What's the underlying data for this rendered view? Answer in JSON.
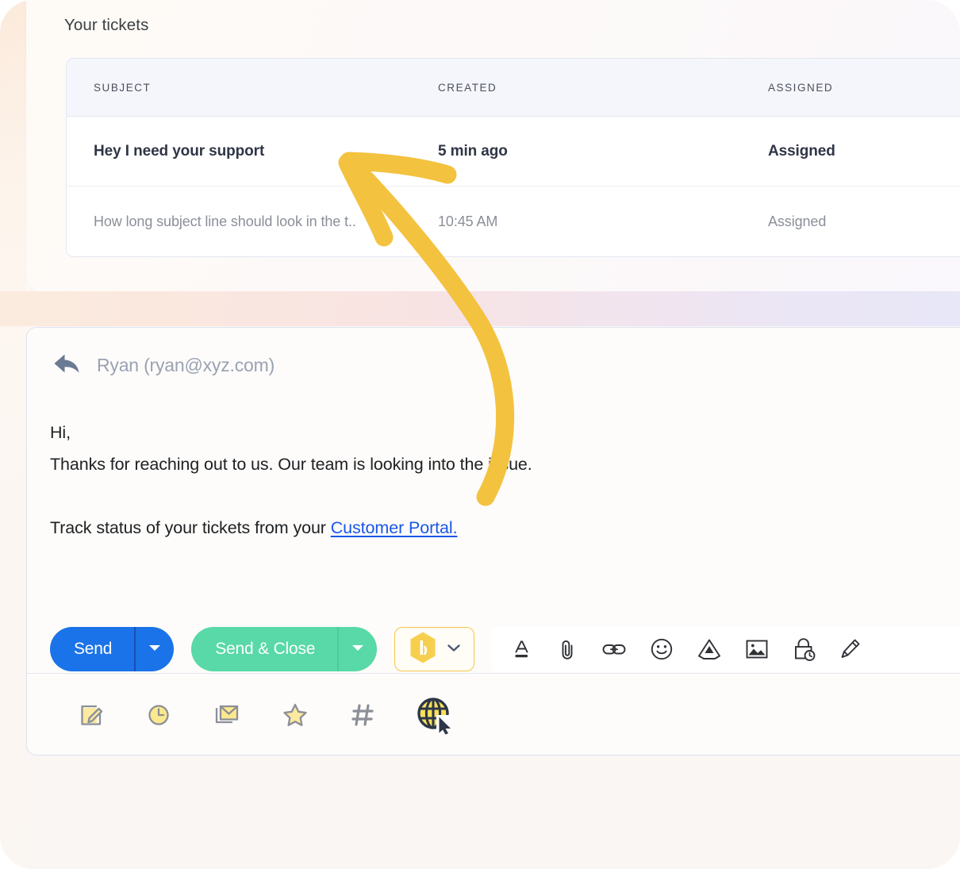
{
  "tickets": {
    "title": "Your tickets",
    "columns": [
      "SUBJECT",
      "CREATED",
      "ASSIGNED"
    ],
    "rows": [
      {
        "subject": "Hey I need your support",
        "created": "5 min ago",
        "assigned": "Assigned",
        "unread": true
      },
      {
        "subject": "How long subject line should look in the t..",
        "created": "10:45 AM",
        "assigned": "Assigned",
        "unread": false
      }
    ]
  },
  "reply": {
    "reply_icon": "reply-arrow-icon",
    "recipient": "Ryan (ryan@xyz.com)",
    "body": {
      "greeting": "Hi,",
      "line1": "Thanks for reaching out to us. Our team is looking into the issue.",
      "line2_prefix": "Track status of your tickets from your ",
      "link_text": "Customer Portal."
    },
    "actions": {
      "send_label": "Send",
      "send_caret": "chevron-down-icon",
      "send_close_label": "Send & Close",
      "send_close_caret": "chevron-down-icon",
      "hiver_icon": "hiver-hexagon-icon",
      "hiver_caret": "chevron-down-icon"
    },
    "format_tools": [
      "text-format-icon",
      "attachment-paperclip-icon",
      "insert-link-icon",
      "emoji-smiley-icon",
      "google-drive-icon",
      "insert-image-icon",
      "confidential-lock-icon",
      "pen-marker-icon"
    ],
    "bottom_tools": [
      "compose-note-icon",
      "snooze-clock-icon",
      "email-template-icon",
      "star-icon",
      "hashtag-tag-icon",
      "globe-cursor-icon"
    ]
  },
  "colors": {
    "send_blue": "#1a73e8",
    "send_close_green": "#58d9a7",
    "hiver_yellow": "#f7cf4f",
    "annotation_yellow": "#f3c23f",
    "link_blue": "#1a56e8",
    "header_bg": "#f4f6fb"
  },
  "annotation": {
    "shape": "curved-arrow-pointing-to-first-ticket-row"
  }
}
